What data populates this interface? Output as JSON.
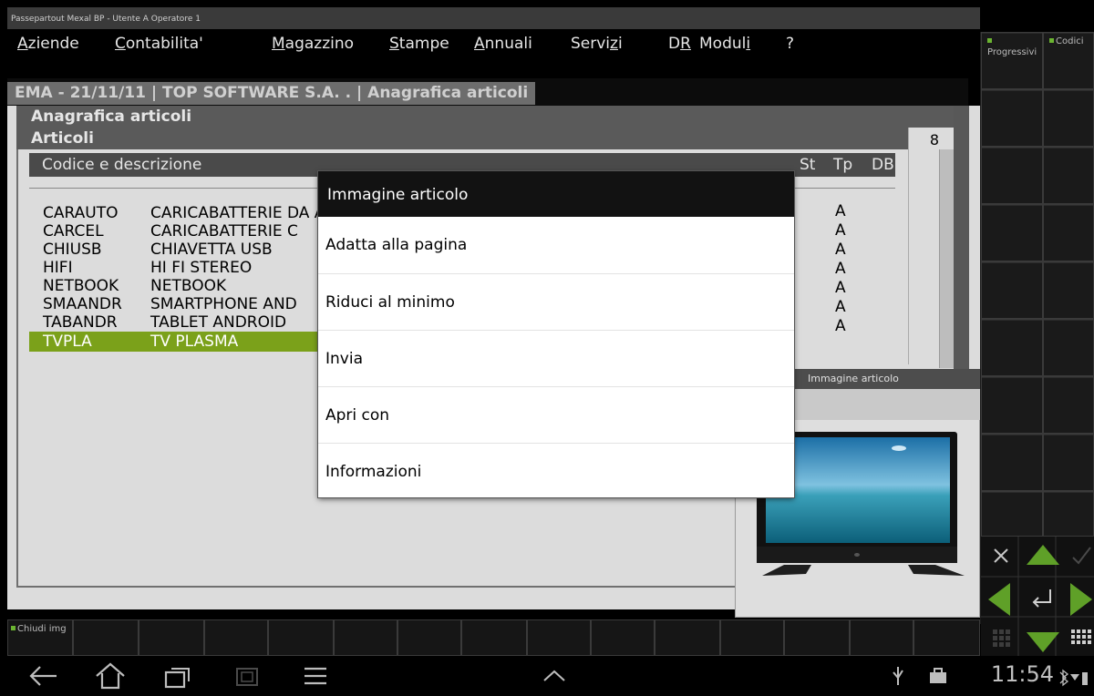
{
  "window_title": "Passepartout Mexal BP - Utente A Operatore 1",
  "menu": [
    {
      "pre": "",
      "ul": "A",
      "post": "ziende"
    },
    {
      "pre": "",
      "ul": "C",
      "post": "ontabilita'"
    },
    {
      "pre": "",
      "ul": "M",
      "post": "agazzino"
    },
    {
      "pre": "",
      "ul": "S",
      "post": "tampe"
    },
    {
      "pre": "",
      "ul": "A",
      "post": "nnuali"
    },
    {
      "pre": "Servi",
      "ul": "z",
      "post": "i"
    },
    {
      "pre": "D",
      "ul": "R",
      "post": ""
    },
    {
      "pre": "Modul",
      "ul": "i",
      "post": ""
    },
    {
      "pre": "",
      "ul": "",
      "post": "?"
    }
  ],
  "context_title": "EMA - 21/11/11 | TOP SOFTWARE S.A. . | Anagrafica articoli",
  "window": {
    "title": "Anagrafica articoli",
    "section": "Articoli",
    "count": "8",
    "columns": {
      "code_desc": "Codice e descrizione",
      "st": "St",
      "tp": "Tp",
      "db": "DB"
    }
  },
  "articles": [
    {
      "code": "CARAUTO",
      "desc": "CARICABATTERIE DA AUTO",
      "tp": "A"
    },
    {
      "code": "CARCEL",
      "desc": "CARICABATTERIE C",
      "tp": "A"
    },
    {
      "code": "CHIUSB",
      "desc": "CHIAVETTA USB",
      "tp": "A"
    },
    {
      "code": "HIFI",
      "desc": "HI FI STEREO",
      "tp": "A"
    },
    {
      "code": "NETBOOK",
      "desc": "NETBOOK",
      "tp": "A"
    },
    {
      "code": "SMAANDR",
      "desc": "SMARTPHONE AND",
      "tp": "A"
    },
    {
      "code": "TABANDR",
      "desc": "TABLET ANDROID",
      "tp": "A"
    },
    {
      "code": "TVPLA",
      "desc": "TV PLASMA",
      "tp": ""
    }
  ],
  "selected_row": 7,
  "image_panel": {
    "title": "Immagine articolo"
  },
  "popup": {
    "title": "Immagine articolo",
    "items": [
      "Adatta alla pagina",
      "Riduci al minimo",
      "Invia",
      "Apri con",
      "Informazioni"
    ]
  },
  "side_buttons": {
    "progressivi": "Progressivi",
    "codici": "Codici"
  },
  "bottom_buttons": {
    "chiudi": "Chiudi img"
  },
  "status": {
    "time": "11:54"
  },
  "colors": {
    "selected_row": "#7ba11a",
    "green_accent": "#6bb431"
  }
}
